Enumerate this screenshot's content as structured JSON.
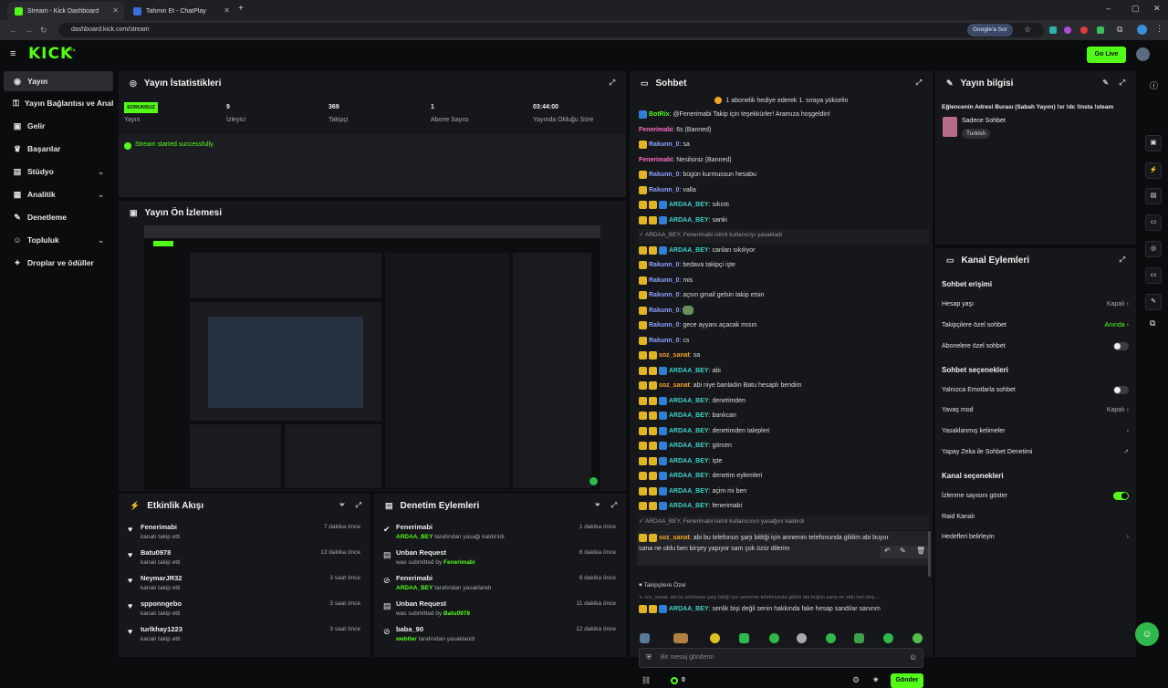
{
  "browser": {
    "tabs": [
      {
        "title": "Stream - Kick Dashboard",
        "active": true
      },
      {
        "title": "Tahmin Et - ChatPlay",
        "active": false
      }
    ],
    "url": "dashboard.kick.com/stream",
    "google_chip": "Google'a Sor"
  },
  "topnav": {
    "logo": "KICK",
    "logo_badge": "BETA",
    "go_live": "Go Live"
  },
  "sidebar": {
    "items": [
      {
        "label": "Yayın",
        "icon": "broadcast-icon"
      },
      {
        "label": "Yayın Bağlantısı ve Anahtarı",
        "icon": "key-icon"
      },
      {
        "label": "Gelir",
        "icon": "money-icon"
      },
      {
        "label": "Başarılar",
        "icon": "trophy-icon"
      },
      {
        "label": "Stüdyo",
        "icon": "studio-icon"
      },
      {
        "label": "Analitik",
        "icon": "analytics-icon"
      },
      {
        "label": "Denetleme",
        "icon": "wrench-icon"
      },
      {
        "label": "Topluluk",
        "icon": "community-icon"
      },
      {
        "label": "Droplar ve ödüller",
        "icon": "gift-icon"
      }
    ]
  },
  "stats": {
    "title": "Yayın İstatistikleri",
    "status_badge": "SORUNSUZ",
    "status_label": "Yayın",
    "cells": [
      {
        "value": "9",
        "label": "İzleyici"
      },
      {
        "value": "369",
        "label": "Takipçi"
      },
      {
        "value": "1",
        "label": "Abone Sayısı"
      },
      {
        "value": "03:44:00",
        "label": "Yayında Olduğu Süre"
      }
    ],
    "message": "Stream started successfully."
  },
  "preview": {
    "title": "Yayın Ön İzlemesi"
  },
  "activity": {
    "title": "Etkinlik Akışı",
    "items": [
      {
        "name": "Fenerimabi",
        "sub": "kanalı takip etti",
        "time": "7 dakika önce"
      },
      {
        "name": "Batu0978",
        "sub": "kanalı takip etti",
        "time": "13 dakika önce"
      },
      {
        "name": "NeymarJR32",
        "sub": "kanalı takip etti",
        "time": "3 saat önce"
      },
      {
        "name": "spponngebo",
        "sub": "kanalı takip etti",
        "time": "3 saat önce"
      },
      {
        "name": "turlkhay1223",
        "sub": "kanalı takip etti",
        "time": "3 saat önce"
      }
    ]
  },
  "moderation": {
    "title": "Denetim Eylemleri",
    "items": [
      {
        "name": "Fenerimabi",
        "by": "ARDAA_BEY",
        "sub": "tarafından yasağı kaldırıldı",
        "time": "1 dakika önce"
      },
      {
        "name": "Unban Request",
        "by": "Fenerimabi",
        "sub": "was submitted by",
        "time": "6 dakika önce"
      },
      {
        "name": "Fenerimabi",
        "by": "ARDAA_BEY",
        "sub": "tarafından yasaklandı",
        "time": "8 dakika önce"
      },
      {
        "name": "Unban Request",
        "by": "Batu0978",
        "sub": "was submitted by",
        "time": "11 dakika önce"
      },
      {
        "name": "baba_90",
        "by": "webtler",
        "sub": "tarafından yasaklandı",
        "time": "12 dakika önce"
      }
    ]
  },
  "chat": {
    "title": "Sohbet",
    "pinned": "1 abonelik hediye ederek 1. sıraya yükselin",
    "lines": [
      {
        "user": "BotRix",
        "text": ": @Fenerimabi Takip için teşekkürler! Aramıza hoşgeldin!",
        "color": "#53fc18",
        "badges": [
          "b-blue"
        ]
      },
      {
        "user": "Fenerimabi",
        "text": ": 6s (Banned)",
        "color": "#ff6ec7",
        "badges": []
      },
      {
        "user": "Rakunn_0",
        "text": ": sa",
        "color": "#8ea0ff",
        "badges": [
          "b-yellow"
        ]
      },
      {
        "user": "Fenerimabi",
        "text": ": Nesilsiniz (Banned)",
        "color": "#ff6ec7",
        "badges": []
      },
      {
        "user": "Rakunn_0",
        "text": ": bügün kurmussun hesabu",
        "color": "#8ea0ff",
        "badges": [
          "b-yellow"
        ]
      },
      {
        "user": "Rakunn_0",
        "text": ": valla",
        "color": "#8ea0ff",
        "badges": [
          "b-yellow"
        ]
      },
      {
        "user": "ARDAA_BEY",
        "text": ": sıkıntı",
        "color": "#3fd0c8",
        "badges": [
          "b-yellow",
          "b-yellow",
          "b-blue"
        ]
      },
      {
        "user": "ARDAA_BEY",
        "text": ": sanki",
        "color": "#3fd0c8",
        "badges": [
          "b-yellow",
          "b-yellow",
          "b-blue"
        ]
      },
      {
        "user": "",
        "text": "ARDAA_BEY, Fenerimabi isimli kullanıcıyı yasakladı",
        "color": "#aaa",
        "badges": [],
        "system": true
      },
      {
        "user": "ARDAA_BEY",
        "text": ": canları sıkılıyor",
        "color": "#3fd0c8",
        "badges": [
          "b-yellow",
          "b-yellow",
          "b-blue"
        ]
      },
      {
        "user": "Rakunn_0",
        "text": ": bedava takipçi işte",
        "color": "#8ea0ff",
        "badges": [
          "b-yellow"
        ]
      },
      {
        "user": "Rakunn_0",
        "text": ": mis",
        "color": "#8ea0ff",
        "badges": [
          "b-yellow"
        ]
      },
      {
        "user": "Rakunn_0",
        "text": ": açsın gmail gelsin takip etsin",
        "color": "#8ea0ff",
        "badges": [
          "b-yellow"
        ]
      },
      {
        "user": "Rakunn_0",
        "text": ":",
        "color": "#8ea0ff",
        "badges": [
          "b-yellow"
        ]
      },
      {
        "user": "Rakunn_0",
        "text": ": gece ayyanı açacak mısın",
        "color": "#8ea0ff",
        "badges": [
          "b-yellow"
        ]
      },
      {
        "user": "Rakunn_0",
        "text": ": cs",
        "color": "#8ea0ff",
        "badges": [
          "b-yellow"
        ]
      },
      {
        "user": "soz_sanat",
        "text": ": sa",
        "color": "#f5a524",
        "badges": [
          "b-yellow",
          "b-yellow"
        ]
      },
      {
        "user": "ARDAA_BEY",
        "text": ": abi",
        "color": "#3fd0c8",
        "badges": [
          "b-yellow",
          "b-yellow",
          "b-blue"
        ]
      },
      {
        "user": "soz_sanat",
        "text": ": abi niye banladın Batu hesaplı bendim",
        "color": "#f5a524",
        "badges": [
          "b-yellow",
          "b-yellow"
        ]
      },
      {
        "user": "ARDAA_BEY",
        "text": ": denetimden",
        "color": "#3fd0c8",
        "badges": [
          "b-yellow",
          "b-yellow",
          "b-blue"
        ]
      },
      {
        "user": "ARDAA_BEY",
        "text": ": banlıcan",
        "color": "#3fd0c8",
        "badges": [
          "b-yellow",
          "b-yellow",
          "b-blue"
        ]
      },
      {
        "user": "ARDAA_BEY",
        "text": ": denetimden talepleri",
        "color": "#3fd0c8",
        "badges": [
          "b-yellow",
          "b-yellow",
          "b-blue"
        ]
      },
      {
        "user": "ARDAA_BEY",
        "text": ": görcen",
        "color": "#3fd0c8",
        "badges": [
          "b-yellow",
          "b-yellow",
          "b-blue"
        ]
      },
      {
        "user": "ARDAA_BEY",
        "text": ": işte",
        "color": "#3fd0c8",
        "badges": [
          "b-yellow",
          "b-yellow",
          "b-blue"
        ]
      },
      {
        "user": "ARDAA_BEY",
        "text": ": denetim eylemleri",
        "color": "#3fd0c8",
        "badges": [
          "b-yellow",
          "b-yellow",
          "b-blue"
        ]
      },
      {
        "user": "ARDAA_BEY",
        "text": ": açim mi ben",
        "color": "#3fd0c8",
        "badges": [
          "b-yellow",
          "b-yellow",
          "b-blue"
        ]
      },
      {
        "user": "ARDAA_BEY",
        "text": ": fenerimabi",
        "color": "#3fd0c8",
        "badges": [
          "b-yellow",
          "b-yellow",
          "b-blue"
        ]
      },
      {
        "user": "",
        "text": "ARDAA_BEY, Fenerimabi isimli kullanıcının yasağını kaldırdı",
        "color": "#aaa",
        "badges": [],
        "system": true
      }
    ],
    "long_msg_user": "soz_sanat",
    "long_msg_text": ": abi bu telefonun şarjı bittiği için annemin telefonunda gildim abi buyur",
    "long_msg_cont": "sana ne oldu ben birşey yapıyor sam çok özür dilerim",
    "reply_preview": "soz_sanat: abi bu telefonun şarjı bittiği için annemin telefonunda gildim abi bugün sana ne oldu ben birş...",
    "last_user": "ARDAA_BEY",
    "last_text": ": senlik bişi değil senin hakkında fake hesap sandılar sanırım",
    "followers_only": "Takipçilere Özel",
    "input_placeholder": "Bir mesaj gönderin",
    "points": "0",
    "send_label": "Gönder"
  },
  "stream_info": {
    "title": "Yayın bilgisi",
    "stream_title": "Eğlencenin Adresi Burası (Sabah Yayını) !sr !dc !insta !steam",
    "category": "Sadece Sohbet",
    "tag": "Turkish"
  },
  "channel_actions": {
    "title": "Kanal Eylemleri",
    "chat_access": "Sohbet erişimi",
    "account_age": {
      "label": "Hesap yaşı",
      "value": "Kapalı"
    },
    "followers_chat": {
      "label": "Takipçilere özel sohbet",
      "value": "Anında"
    },
    "subs_chat": {
      "label": "Abonelere özel sohbet"
    },
    "chat_options": "Sohbet seçenekleri",
    "emotes_only": {
      "label": "Yalnızca Emotlarla sohbet"
    },
    "slow_mode": {
      "label": "Yavaş mod",
      "value": "Kapalı"
    },
    "banned_words": {
      "label": "Yasaklanmış kelimeler"
    },
    "ai_moderation": {
      "label": "Yapay Zeka ile Sohbet Denetimi"
    },
    "channel_options": "Kanal seçenekleri",
    "show_viewers": {
      "label": "İzlenme sayısını göster"
    },
    "raid": {
      "label": "Raid Kanalı"
    },
    "goals": {
      "label": "Hedefleri belirleyin"
    }
  },
  "colors": {
    "accent": "#53fc18",
    "panel": "#16171a",
    "bg": "#0b0c0e"
  }
}
